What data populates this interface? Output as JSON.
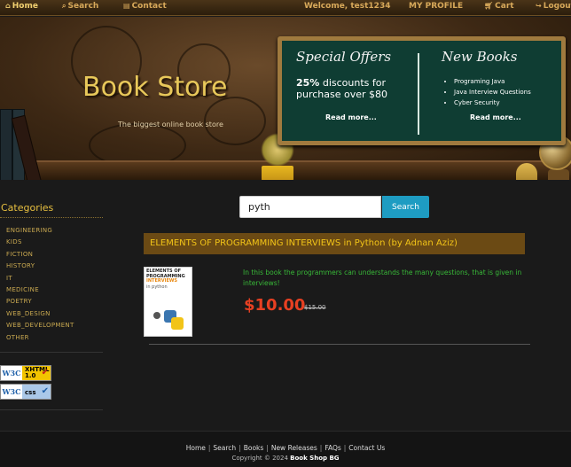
{
  "nav": {
    "home": "Home",
    "search": "Search",
    "contact": "Contact",
    "welcome": "Welcome, test1234",
    "profile": "MY PROFILE",
    "cart": "Cart",
    "logout": "Logout"
  },
  "banner": {
    "title": "Book Store",
    "subtitle": "The biggest online book store",
    "special_offers": {
      "heading": "Special Offers",
      "discount_pct": "25%",
      "discount_text": "discounts for purchase over $80",
      "read_more": "Read more..."
    },
    "new_books": {
      "heading": "New Books",
      "items": [
        "Programing Java",
        "Java Interview Questions",
        "Cyber Security"
      ],
      "read_more": "Read more..."
    }
  },
  "sidebar": {
    "title": "Categories",
    "categories": [
      "ENGINEERING",
      "KIDS",
      "FICTION",
      "HISTORY",
      "IT",
      "MEDICINE",
      "POETRY",
      "WEB_DESIGN",
      "WEB_DEVELOPMENT",
      "OTHER"
    ],
    "badges": {
      "w3c": "W3C",
      "xhtml": "XHTML",
      "xhtml_version": "1.0",
      "css": "css"
    }
  },
  "search": {
    "value": "pyth",
    "button": "Search"
  },
  "result": {
    "heading": "ELEMENTS OF PROGRAMMING INTERVIEWS in Python (by Adnan Aziz)",
    "cover": {
      "line1": "ELEMENTS OF",
      "line2": "PROGRAMMING",
      "line3": "INTERVIEWS",
      "line4": "in",
      "line5": "python"
    },
    "description": "In this book the programmers can understands the many questions, that is given in interviews!",
    "price": "$10.00",
    "old_price": "$15.00"
  },
  "footer": {
    "links": [
      "Home",
      "Search",
      "Books",
      "New Releases",
      "FAQs",
      "Contact Us"
    ],
    "copyright_prefix": "Copyright © 2024",
    "copyright_brand": "Book Shop BG"
  }
}
